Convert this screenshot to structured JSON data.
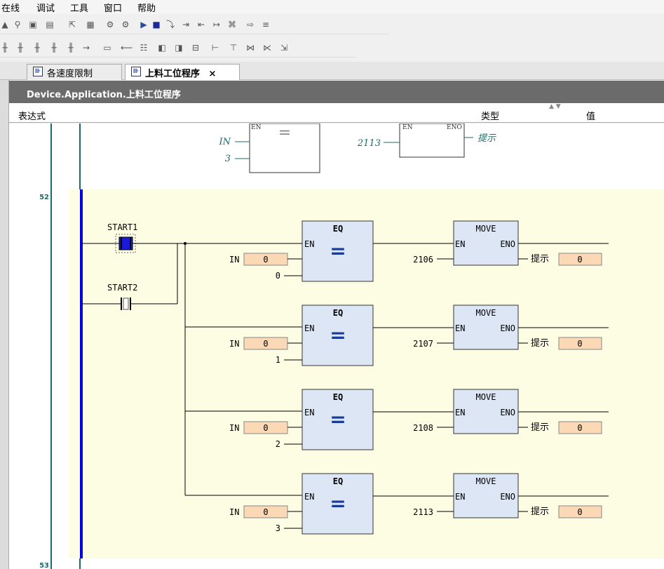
{
  "menu": [
    "在线",
    "调试",
    "工具",
    "窗口",
    "帮助"
  ],
  "tabs": {
    "tab1": "各速度限制",
    "tab2": "上料工位程序",
    "close": "×"
  },
  "path": "Device.Application.上料工位程序",
  "watch": {
    "col_expr": "表达式",
    "col_type": "类型",
    "col_value": "值"
  },
  "network_numbers": {
    "n52": "52",
    "n53": "53"
  },
  "prev_network": {
    "in_label": "IN",
    "in_val": "3",
    "move_in": "2113",
    "out_label": "提示",
    "en": "EN",
    "eno": "ENO"
  },
  "contacts": [
    {
      "name": "START1"
    },
    {
      "name": "START2"
    }
  ],
  "rungs": [
    {
      "eq_title": "EQ",
      "en": "EN",
      "eq_sym": "=",
      "in_label": "IN",
      "in_val": "0",
      "const": "0",
      "move_title": "MOVE",
      "move_en": "EN",
      "move_eno": "ENO",
      "move_in": "2106",
      "out_label": "提示",
      "out_val": "0"
    },
    {
      "eq_title": "EQ",
      "en": "EN",
      "eq_sym": "=",
      "in_label": "IN",
      "in_val": "0",
      "const": "1",
      "move_title": "MOVE",
      "move_en": "EN",
      "move_eno": "ENO",
      "move_in": "2107",
      "out_label": "提示",
      "out_val": "0"
    },
    {
      "eq_title": "EQ",
      "en": "EN",
      "eq_sym": "=",
      "in_label": "IN",
      "in_val": "0",
      "const": "2",
      "move_title": "MOVE",
      "move_en": "EN",
      "move_eno": "ENO",
      "move_in": "2108",
      "out_label": "提示",
      "out_val": "0"
    },
    {
      "eq_title": "EQ",
      "en": "EN",
      "eq_sym": "=",
      "in_label": "IN",
      "in_val": "0",
      "const": "3",
      "move_title": "MOVE",
      "move_en": "EN",
      "move_eno": "ENO",
      "move_in": "2113",
      "out_label": "提示",
      "out_val": "0"
    }
  ]
}
